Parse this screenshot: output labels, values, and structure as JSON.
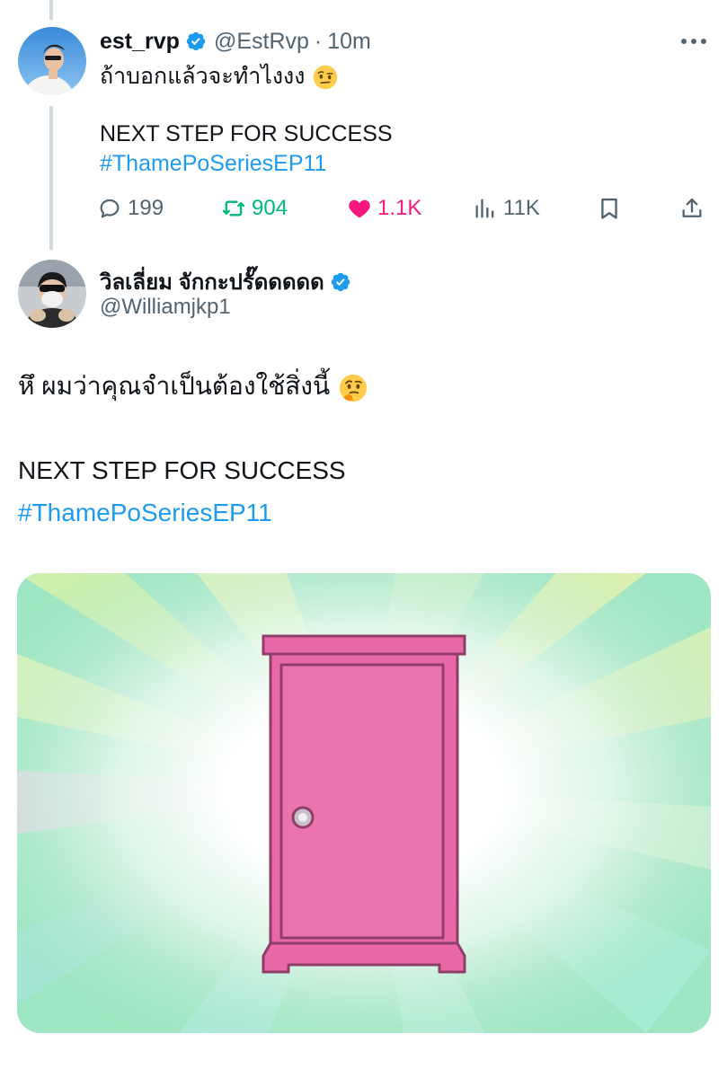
{
  "tweet1": {
    "display_name": "est_rvp",
    "handle": "@EstRvp",
    "separator": "·",
    "time": "10m",
    "text_line1": "ถ้าบอกแล้วจะทำไงงง",
    "text_line1_emoji": "face-with-raised-eyebrow",
    "text_line2": "NEXT STEP FOR SUCCESS",
    "hashtag": "#ThamePoSeriesEP11",
    "actions": {
      "reply_count": "199",
      "retweet_count": "904",
      "like_count": "1.1K",
      "views_count": "11K"
    }
  },
  "tweet2": {
    "display_name": "วิลเลี่ยม จักกะปรั๊ดดดดด",
    "handle": "@Williamjkp1",
    "text_line1": "หึ ผมว่าคุณจำเป็นต้องใช้สิ่งนี้",
    "text_line1_emoji": "thinking-face",
    "text_line2": "NEXT STEP FOR SUCCESS",
    "hashtag": "#ThamePoSeriesEP11",
    "media": "pink-door-illustration"
  },
  "colors": {
    "text": "#0f1419",
    "secondary": "#536471",
    "link": "#1d9bf0",
    "retweet": "#00ba7c",
    "like": "#f91880",
    "verified": "#1d9bf0",
    "door": "#e968a6"
  }
}
